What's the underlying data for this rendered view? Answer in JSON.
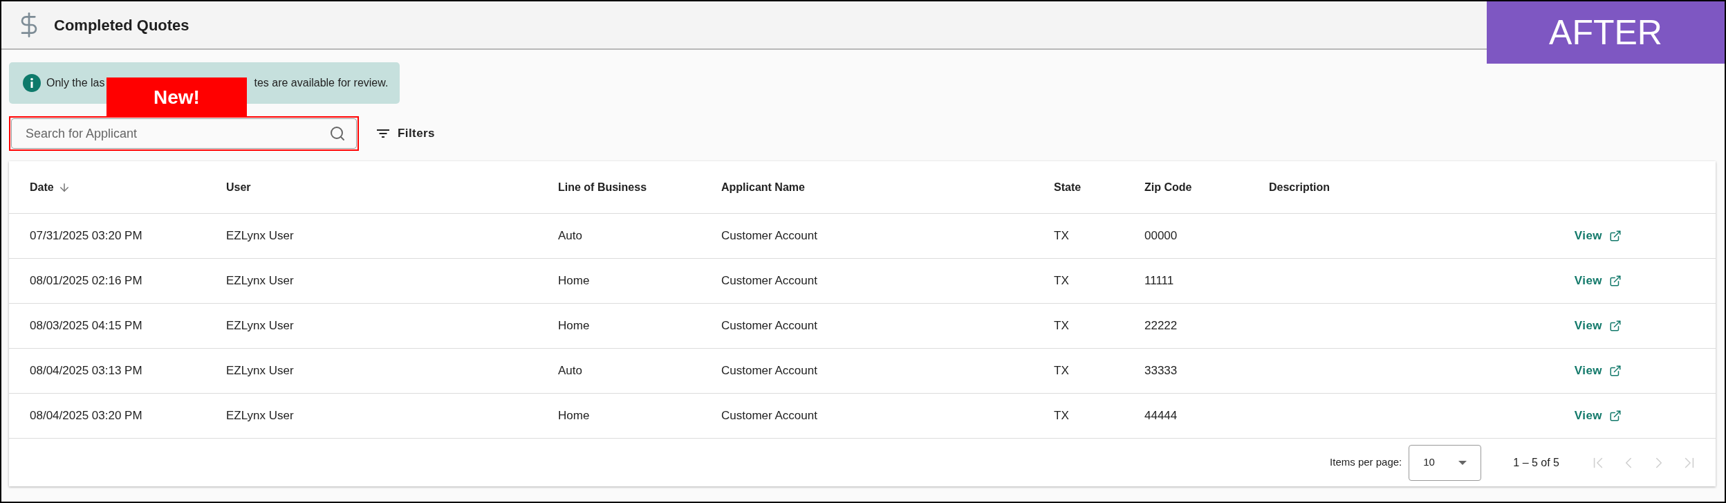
{
  "window": {
    "title": "Completed Quotes"
  },
  "corner_badge": "AFTER",
  "notice": {
    "text_before": "Only the las",
    "text_after": "tes are available for review."
  },
  "new_badge": "New!",
  "search": {
    "placeholder": "Search for Applicant"
  },
  "filters": {
    "label": "Filters"
  },
  "table": {
    "columns": [
      {
        "label": "Date",
        "sorted": true
      },
      {
        "label": "User",
        "sorted": false
      },
      {
        "label": "Line of Business",
        "sorted": false
      },
      {
        "label": "Applicant Name",
        "sorted": false
      },
      {
        "label": "State",
        "sorted": false
      },
      {
        "label": "Zip Code",
        "sorted": false
      },
      {
        "label": "Description",
        "sorted": false
      }
    ],
    "rows": [
      {
        "cells": [
          "07/31/2025 03:20 PM",
          "EZLynx User",
          "Auto",
          "Customer Account",
          "TX",
          "00000"
        ],
        "action": "View"
      },
      {
        "cells": [
          "08/01/2025 02:16 PM",
          "EZLynx User",
          "Home",
          "Customer Account",
          "TX",
          "11111"
        ],
        "action": "View"
      },
      {
        "cells": [
          "08/03/2025 04:15 PM",
          "EZLynx User",
          "Home",
          "Customer Account",
          "TX",
          "22222"
        ],
        "action": "View"
      },
      {
        "cells": [
          "08/04/2025 03:13 PM",
          "EZLynx User",
          "Auto",
          "Customer Account",
          "TX",
          "33333"
        ],
        "action": "View"
      },
      {
        "cells": [
          "08/04/2025 03:20 PM",
          "EZLynx User",
          "Home",
          "Customer Account",
          "TX",
          "44444"
        ],
        "action": "View"
      }
    ]
  },
  "pagination": {
    "label": "Items per page:",
    "page_size": "10",
    "range": "1 – 5 of 5",
    "buttons": [
      {
        "kind": "first",
        "disabled": true
      },
      {
        "kind": "prev",
        "disabled": true
      },
      {
        "kind": "next",
        "disabled": true
      },
      {
        "kind": "last",
        "disabled": true
      }
    ]
  }
}
